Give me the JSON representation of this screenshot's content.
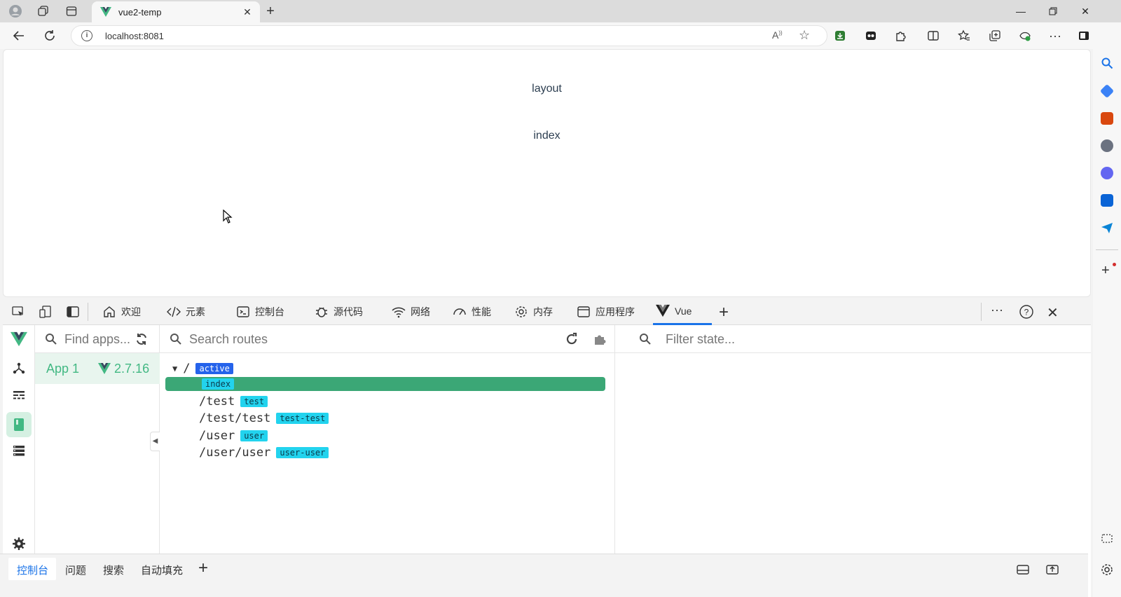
{
  "browser": {
    "tab_title": "vue2-temp",
    "url": "localhost:8081"
  },
  "page": {
    "line1": "layout",
    "line2": "index"
  },
  "devtools": {
    "tabs": [
      {
        "label": "欢迎",
        "icon": "home-icon"
      },
      {
        "label": "元素",
        "icon": "code-icon"
      },
      {
        "label": "控制台",
        "icon": "console-icon"
      },
      {
        "label": "源代码",
        "icon": "bug-icon"
      },
      {
        "label": "网络",
        "icon": "wifi-icon"
      },
      {
        "label": "性能",
        "icon": "gauge-icon"
      },
      {
        "label": "内存",
        "icon": "gear-icon"
      },
      {
        "label": "应用程序",
        "icon": "window-icon"
      },
      {
        "label": "Vue",
        "icon": "vue-icon"
      }
    ],
    "active_tab": "Vue"
  },
  "vue": {
    "find_apps_placeholder": "Find apps...",
    "app_name": "App 1",
    "vue_version": "2.7.16",
    "search_routes_placeholder": "Search routes",
    "filter_state_placeholder": "Filter state...",
    "routes": [
      {
        "path": "/",
        "tag": "active",
        "tag_style": "blue"
      },
      {
        "path": "",
        "tag": "index",
        "tag_style": "cyan",
        "selected": true
      },
      {
        "path": "/test",
        "tag": "test",
        "tag_style": "cyan"
      },
      {
        "path": "/test/test",
        "tag": "test-test",
        "tag_style": "cyan"
      },
      {
        "path": "/user",
        "tag": "user",
        "tag_style": "cyan"
      },
      {
        "path": "/user/user",
        "tag": "user-user",
        "tag_style": "cyan"
      }
    ]
  },
  "drawer": {
    "tabs": [
      "控制台",
      "问题",
      "搜索",
      "自动填充"
    ],
    "active_tab": "控制台"
  },
  "colors": {
    "vue_green": "#42b883",
    "selection_green": "#3ba776",
    "tag_cyan": "#22d3ee",
    "tag_blue": "#2563eb",
    "devtools_accent": "#1a73e8"
  }
}
